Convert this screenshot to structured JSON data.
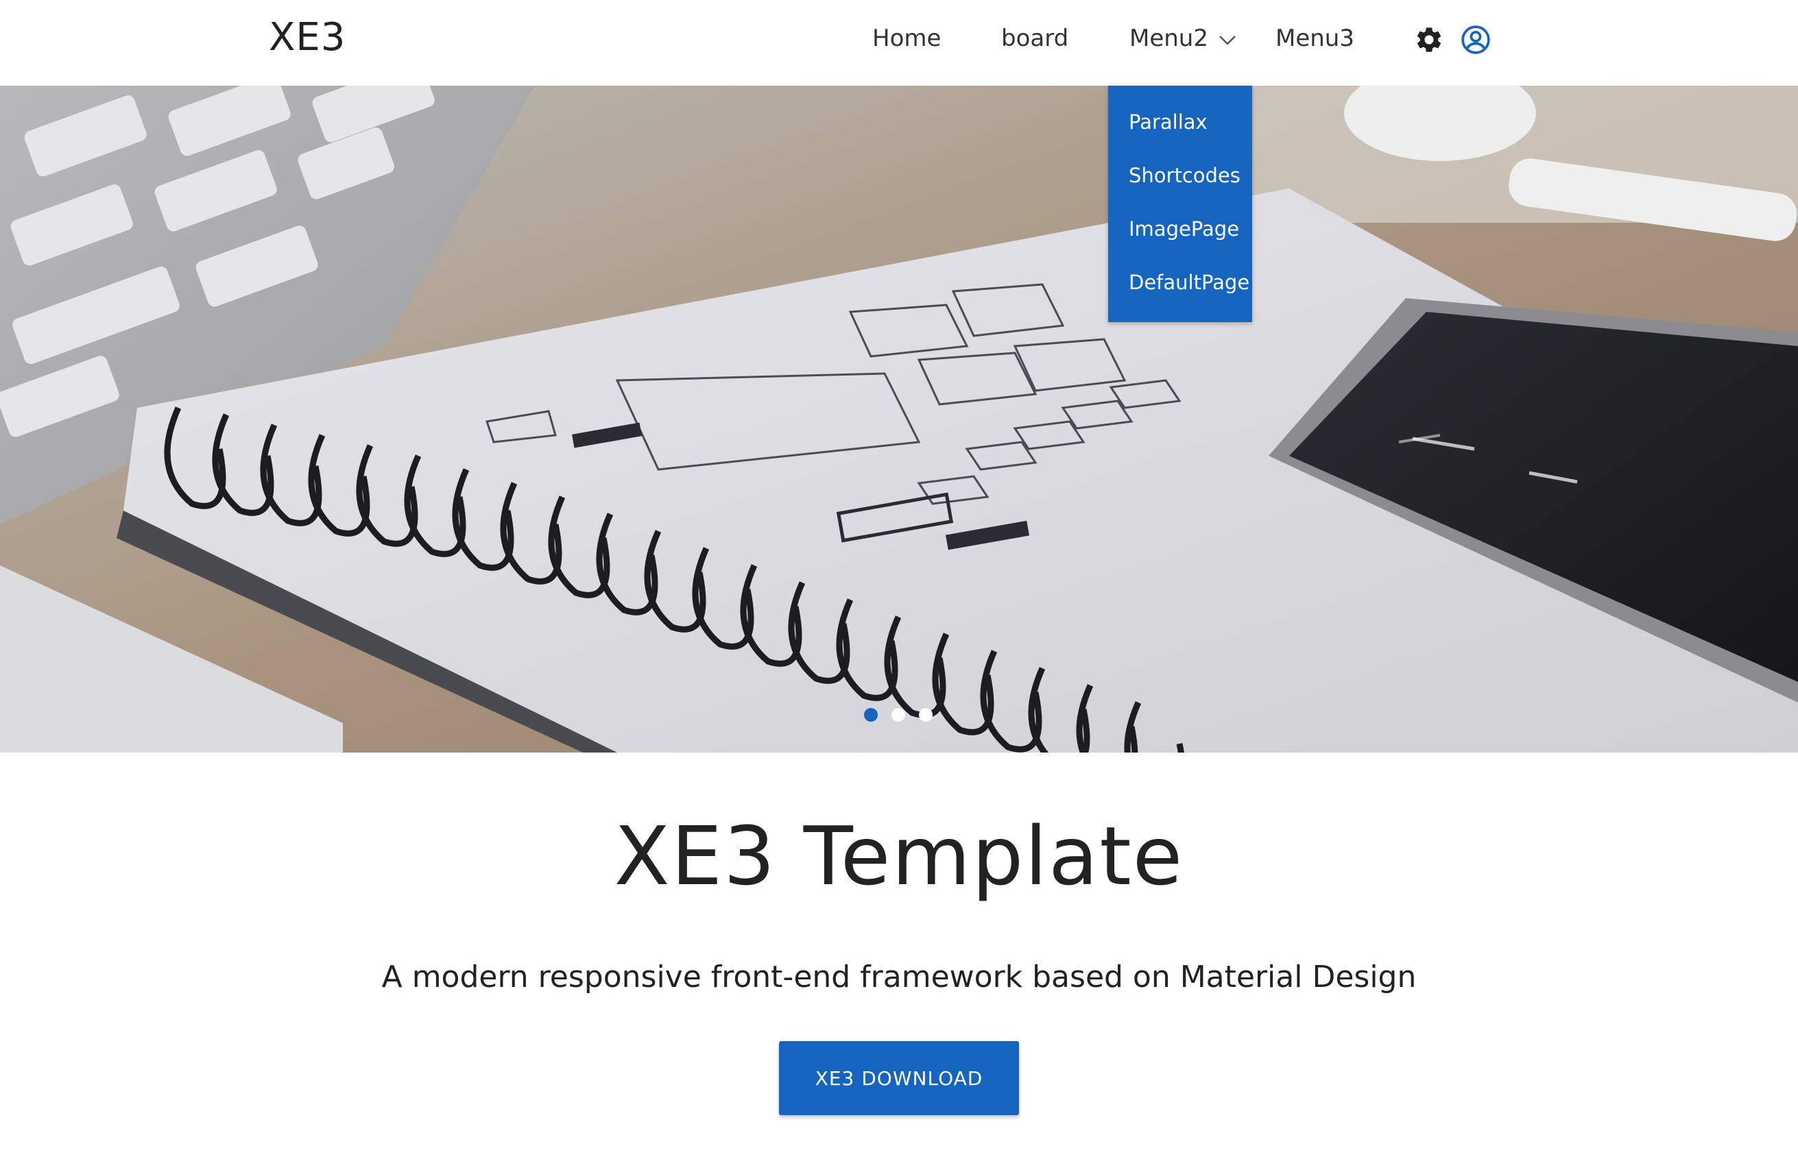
{
  "header": {
    "logo": "XE3",
    "nav": [
      {
        "label": "Home"
      },
      {
        "label": "board"
      },
      {
        "label": "Menu2"
      },
      {
        "label": "Menu3"
      }
    ],
    "icons": {
      "settings": "gear-icon",
      "account": "user-circle-icon",
      "menu2_toggle": "chevron-down-icon"
    }
  },
  "dropdown": {
    "items": [
      {
        "label": "Parallax"
      },
      {
        "label": "Shortcodes"
      },
      {
        "label": "ImagePage"
      },
      {
        "label": "DefaultPage"
      }
    ]
  },
  "hero": {
    "slides_total": 3,
    "active_slide": 1
  },
  "main": {
    "title": "XE3 Template",
    "subtitle": "A modern responsive front-end framework based on Material Design",
    "button_label": "XE3 DOWNLOAD"
  },
  "colors": {
    "accent": "#1565c0",
    "text": "#222222",
    "background": "#ffffff"
  }
}
